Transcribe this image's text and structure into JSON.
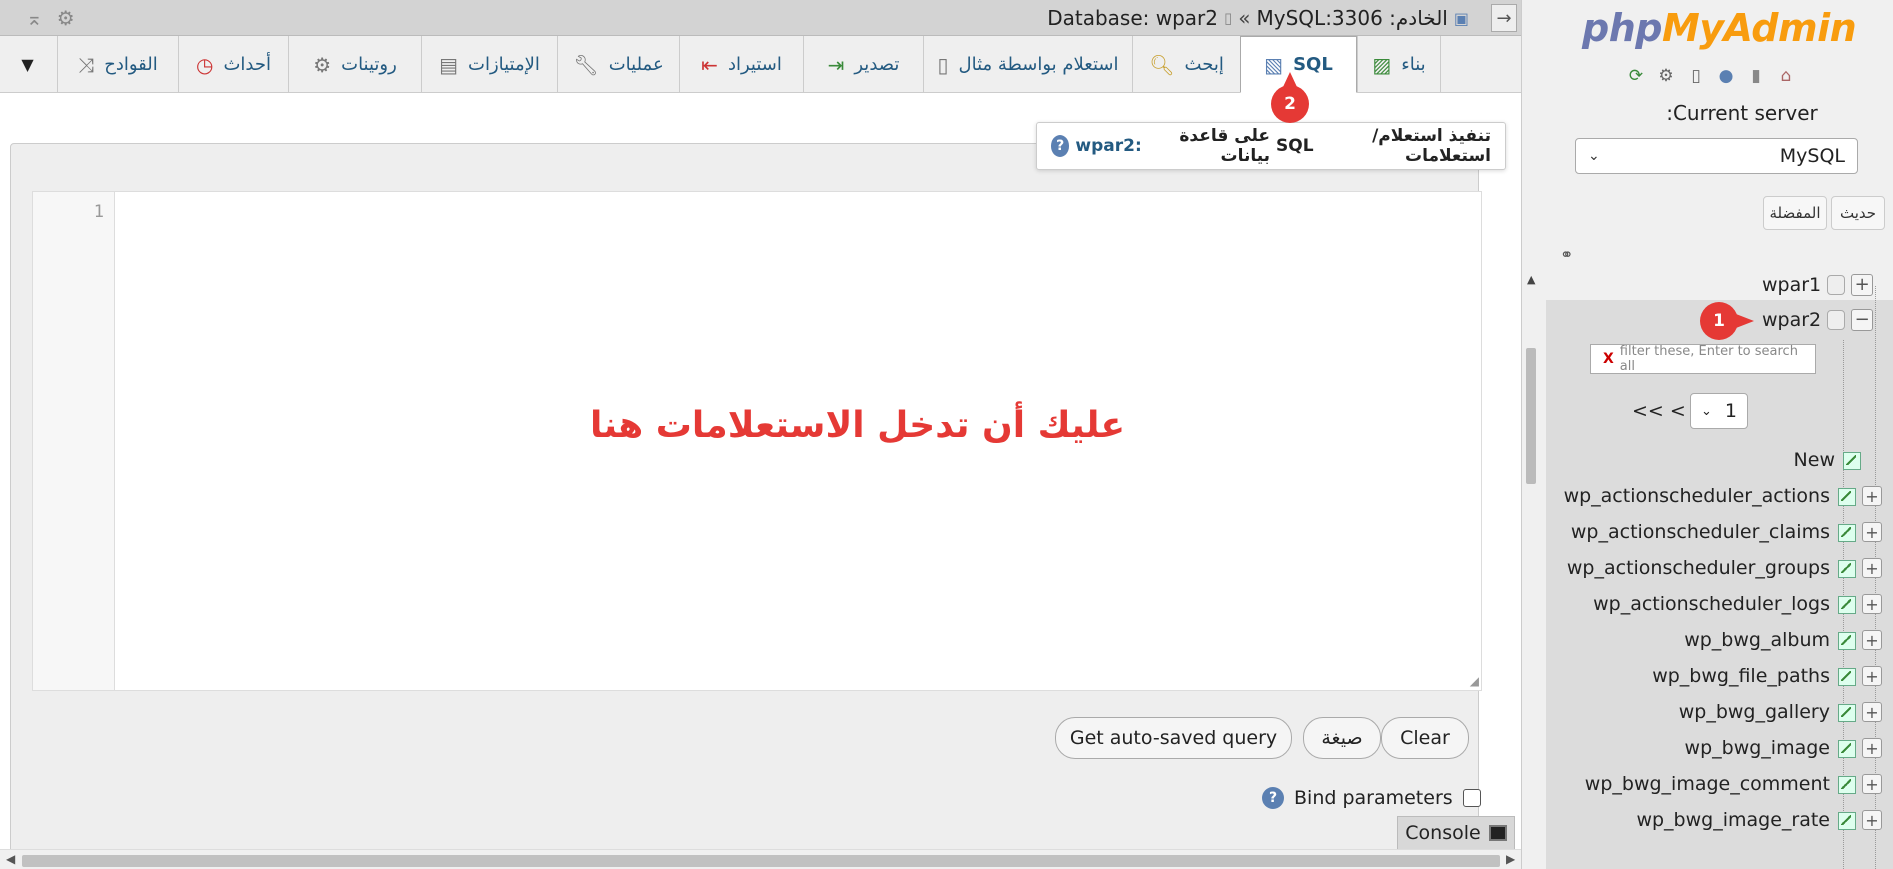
{
  "topbar": {
    "collapse_icon": "collapse-up-icon",
    "settings_icon": "gear-icon",
    "breadcrumb": {
      "server_label": "الخادم: MySQL:3306",
      "separator": "»",
      "database_label": "Database: wpar2"
    },
    "arrow_icon": "arrow-right-icon"
  },
  "tabs": [
    {
      "label": "بناء",
      "icon": "structure-icon"
    },
    {
      "label": "SQL",
      "icon": "sql-icon",
      "active": true
    },
    {
      "label": "إبحث",
      "icon": "search-icon"
    },
    {
      "label": "استعلام بواسطة مثال",
      "icon": "query-icon"
    },
    {
      "label": "تصدير",
      "icon": "export-icon"
    },
    {
      "label": "استيراد",
      "icon": "import-icon"
    },
    {
      "label": "عمليات",
      "icon": "wrench-icon"
    },
    {
      "label": "الإمتيازات",
      "icon": "privileges-icon"
    },
    {
      "label": "روتينات",
      "icon": "routines-icon"
    },
    {
      "label": "أحداث",
      "icon": "clock-icon"
    },
    {
      "label": "القوادح",
      "icon": "triggers-icon"
    }
  ],
  "more_tabs_icon": "chevron-down-icon",
  "main": {
    "heading": {
      "prefix": "تنفيذ استعلام/استعلامات",
      "sql": "SQL",
      "middle": "على قاعدة بيانات",
      "db": "wpar2:"
    },
    "editor": {
      "line_number": "1",
      "overlay_text": "عليك أن تدخل الاستعلامات هنا"
    },
    "buttons": {
      "clear": "Clear",
      "format": "صيغة",
      "autosaved": "Get auto-saved query"
    },
    "bind_parameters": "Bind parameters",
    "console": "Console"
  },
  "annotations": {
    "badge1": "1",
    "badge2": "2",
    "color": "#e53935"
  },
  "nav": {
    "logo_php": "php",
    "logo_rest": "MyAdmin",
    "icons": [
      "home-icon",
      "exit-icon",
      "help-icon",
      "docs-icon",
      "settings-icon",
      "reload-icon"
    ],
    "current_server_label": "Current server:",
    "server_value": "MySQL",
    "tab_recent": "حديث",
    "tab_favorites": "المفضلة",
    "link_icon": "link-icon",
    "databases": [
      {
        "name": "wpar1",
        "expanded": false
      },
      {
        "name": "wpar2",
        "expanded": true
      }
    ],
    "filter_placeholder": "filter these, Enter to search all",
    "filter_clear": "X",
    "pager_arrows": "<< <",
    "page_value": "1",
    "new_label": "New",
    "tables": [
      "wp_actionscheduler_actions",
      "wp_actionscheduler_claims",
      "wp_actionscheduler_groups",
      "wp_actionscheduler_logs",
      "wp_bwg_album",
      "wp_bwg_file_paths",
      "wp_bwg_gallery",
      "wp_bwg_image",
      "wp_bwg_image_comment",
      "wp_bwg_image_rate"
    ]
  },
  "colors": {
    "tab_text": "#235a81",
    "logo_php": "#6c78af",
    "logo_rest": "#f89c0e",
    "annotation": "#e53935"
  }
}
